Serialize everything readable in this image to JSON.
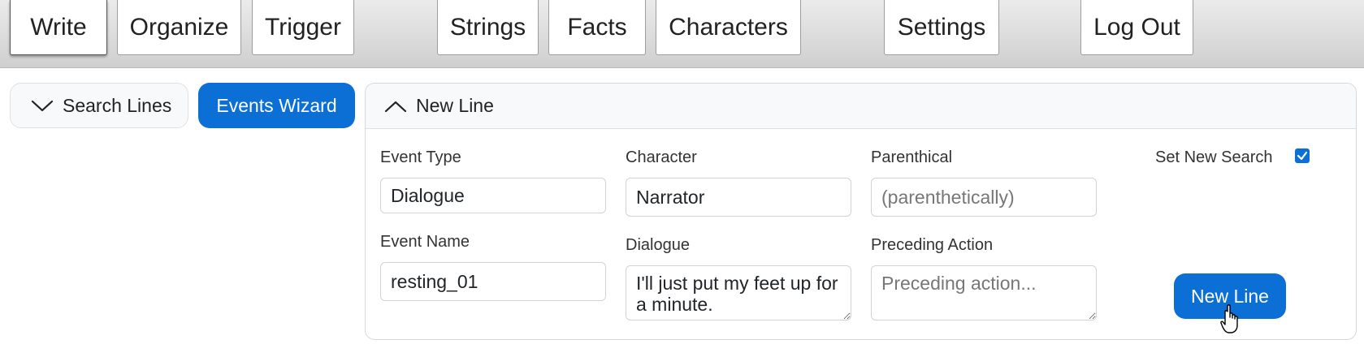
{
  "nav": {
    "write": "Write",
    "organize": "Organize",
    "trigger": "Trigger",
    "strings": "Strings",
    "facts": "Facts",
    "characters": "Characters",
    "settings": "Settings",
    "logout": "Log Out",
    "active": "Write"
  },
  "left": {
    "search_lines": "Search Lines",
    "search_lines_icon": "chevron-down-icon",
    "events_wizard": "Events Wizard"
  },
  "card": {
    "title": "New Line",
    "title_icon": "chevron-up-icon",
    "event_type_label": "Event Type",
    "event_type_value": "Dialogue",
    "character_label": "Character",
    "character_value": "Narrator",
    "parenthical_label": "Parenthical",
    "parenthical_placeholder": "(parenthetically)",
    "set_new_search_label": "Set New Search",
    "set_new_search_checked": true,
    "event_name_label": "Event Name",
    "event_name_value": "resting_01",
    "dialogue_label": "Dialogue",
    "dialogue_value": "I'll just put my feet up for a minute.",
    "preceding_action_label": "Preceding Action",
    "preceding_action_placeholder": "Preceding action...",
    "new_line_button": "New Line"
  },
  "colors": {
    "primary": "#0b6fd5",
    "topbar": "#d6d6d6"
  }
}
